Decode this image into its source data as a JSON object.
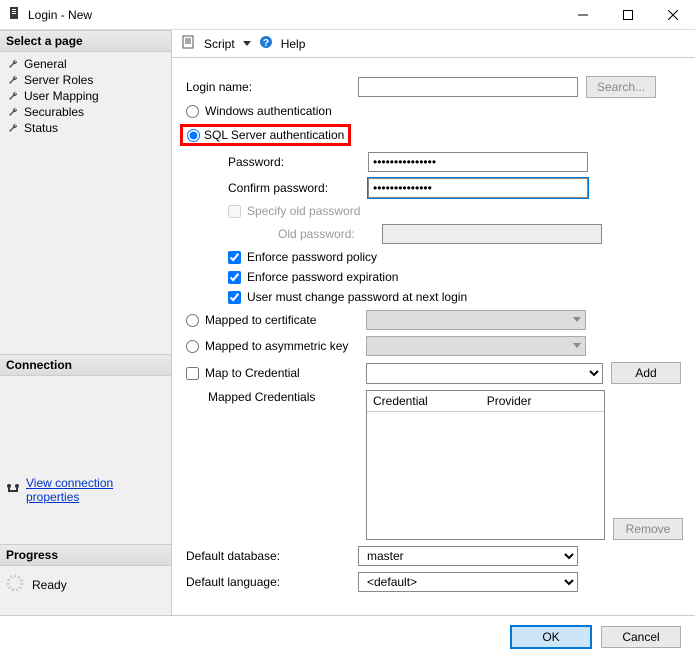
{
  "window": {
    "title": "Login - New"
  },
  "toolbar": {
    "script": "Script",
    "help": "Help"
  },
  "sidebar": {
    "select_page": "Select a page",
    "items": [
      {
        "label": "General"
      },
      {
        "label": "Server Roles"
      },
      {
        "label": "User Mapping"
      },
      {
        "label": "Securables"
      },
      {
        "label": "Status"
      }
    ],
    "connection_hdr": "Connection",
    "view_conn_props": "View connection properties",
    "progress_hdr": "Progress",
    "progress_status": "Ready"
  },
  "form": {
    "login_name": "Login name:",
    "search_btn": "Search...",
    "auth_windows": "Windows authentication",
    "auth_sql": "SQL Server authentication",
    "password_lbl": "Password:",
    "password_val": "●●●●●●●●●●●●●●●",
    "confirm_pw_lbl": "Confirm password:",
    "confirm_pw_val": "●●●●●●●●●●●●●●",
    "specify_old_pw": "Specify old password",
    "old_pw_lbl": "Old password:",
    "enforce_policy": "Enforce password policy",
    "enforce_exp": "Enforce password expiration",
    "must_change": "User must change password at next login",
    "mapped_cert": "Mapped to certificate",
    "mapped_asym": "Mapped to asymmetric key",
    "map_cred": "Map to Credential",
    "add_btn": "Add",
    "mapped_creds_lbl": "Mapped Credentials",
    "col_cred": "Credential",
    "col_prov": "Provider",
    "remove_btn": "Remove",
    "default_db_lbl": "Default database:",
    "default_db_val": "master",
    "default_lang_lbl": "Default language:",
    "default_lang_val": "<default>"
  },
  "footer": {
    "ok": "OK",
    "cancel": "Cancel"
  }
}
